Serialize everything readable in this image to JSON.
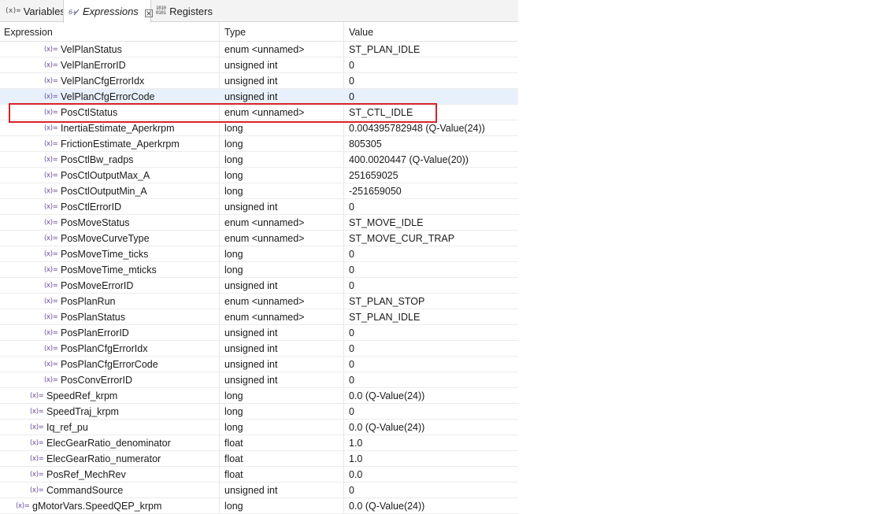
{
  "tabs": [
    {
      "label": "Variables",
      "icon": "(x)="
    },
    {
      "label": "Expressions",
      "icon": "expression-icon"
    },
    {
      "label": "Registers",
      "icon": "1010 0101"
    }
  ],
  "active_tab": "Expressions",
  "columns": {
    "expression": "Expression",
    "type": "Type",
    "value": "Value"
  },
  "var_icon_text": "(x)=",
  "rows": [
    {
      "name": "VelPlanStatus",
      "type": "enum <unnamed>",
      "value": "ST_PLAN_IDLE",
      "indent": 3
    },
    {
      "name": "VelPlanErrorID",
      "type": "unsigned int",
      "value": "0",
      "indent": 3
    },
    {
      "name": "VelPlanCfgErrorIdx",
      "type": "unsigned int",
      "value": "0",
      "indent": 3
    },
    {
      "name": "VelPlanCfgErrorCode",
      "type": "unsigned int",
      "value": "0",
      "indent": 3,
      "highlight": true
    },
    {
      "name": "PosCtlStatus",
      "type": "enum <unnamed>",
      "value": "ST_CTL_IDLE",
      "indent": 3,
      "boxed": true
    },
    {
      "name": "InertiaEstimate_Aperkrpm",
      "type": "long",
      "value": "0.004395782948 (Q-Value(24))",
      "indent": 3
    },
    {
      "name": "FrictionEstimate_Aperkrpm",
      "type": "long",
      "value": "805305",
      "indent": 3
    },
    {
      "name": "PosCtlBw_radps",
      "type": "long",
      "value": "400.0020447 (Q-Value(20))",
      "indent": 3
    },
    {
      "name": "PosCtlOutputMax_A",
      "type": "long",
      "value": "251659025",
      "indent": 3
    },
    {
      "name": "PosCtlOutputMin_A",
      "type": "long",
      "value": "-251659050",
      "indent": 3
    },
    {
      "name": "PosCtlErrorID",
      "type": "unsigned int",
      "value": "0",
      "indent": 3
    },
    {
      "name": "PosMoveStatus",
      "type": "enum <unnamed>",
      "value": "ST_MOVE_IDLE",
      "indent": 3
    },
    {
      "name": "PosMoveCurveType",
      "type": "enum <unnamed>",
      "value": "ST_MOVE_CUR_TRAP",
      "indent": 3
    },
    {
      "name": "PosMoveTime_ticks",
      "type": "long",
      "value": "0",
      "indent": 3
    },
    {
      "name": "PosMoveTime_mticks",
      "type": "long",
      "value": "0",
      "indent": 3
    },
    {
      "name": "PosMoveErrorID",
      "type": "unsigned int",
      "value": "0",
      "indent": 3
    },
    {
      "name": "PosPlanRun",
      "type": "enum <unnamed>",
      "value": "ST_PLAN_STOP",
      "indent": 3
    },
    {
      "name": "PosPlanStatus",
      "type": "enum <unnamed>",
      "value": "ST_PLAN_IDLE",
      "indent": 3
    },
    {
      "name": "PosPlanErrorID",
      "type": "unsigned int",
      "value": "0",
      "indent": 3
    },
    {
      "name": "PosPlanCfgErrorIdx",
      "type": "unsigned int",
      "value": "0",
      "indent": 3
    },
    {
      "name": "PosPlanCfgErrorCode",
      "type": "unsigned int",
      "value": "0",
      "indent": 3
    },
    {
      "name": "PosConvErrorID",
      "type": "unsigned int",
      "value": "0",
      "indent": 3
    },
    {
      "name": "SpeedRef_krpm",
      "type": "long",
      "value": "0.0 (Q-Value(24))",
      "indent": 2
    },
    {
      "name": "SpeedTraj_krpm",
      "type": "long",
      "value": "0",
      "indent": 2
    },
    {
      "name": "Iq_ref_pu",
      "type": "long",
      "value": "0.0 (Q-Value(24))",
      "indent": 2
    },
    {
      "name": "ElecGearRatio_denominator",
      "type": "float",
      "value": "1.0",
      "indent": 2
    },
    {
      "name": "ElecGearRatio_numerator",
      "type": "float",
      "value": "1.0",
      "indent": 2
    },
    {
      "name": "PosRef_MechRev",
      "type": "float",
      "value": "0.0",
      "indent": 2
    },
    {
      "name": "CommandSource",
      "type": "unsigned int",
      "value": "0",
      "indent": 2
    },
    {
      "name": "gMotorVars.SpeedQEP_krpm",
      "type": "long",
      "value": "0.0 (Q-Value(24))",
      "indent": 1
    }
  ]
}
